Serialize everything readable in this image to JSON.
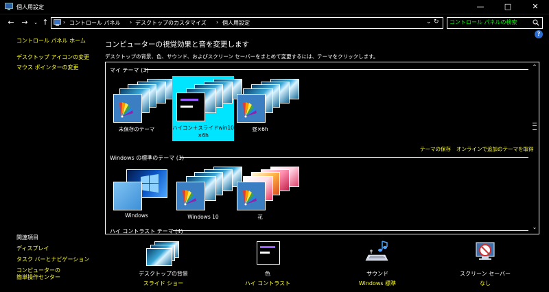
{
  "window": {
    "title": "個人用設定"
  },
  "address": {
    "crumbs": [
      "コントロール パネル",
      "デスクトップのカスタマイズ",
      "個人用設定"
    ],
    "search_placeholder": "コントロール パネルの検索"
  },
  "sidebar": {
    "home": "コントロール パネル ホーム",
    "links": [
      "デスクトップ アイコンの変更",
      "マウス ポインターの変更"
    ],
    "related_title": "関連項目",
    "related": [
      "ディスプレイ",
      "タスク バーとナビゲーション"
    ],
    "ease_line1": "コンピューターの",
    "ease_line2": "簡単操作センター"
  },
  "main": {
    "title": "コンピューターの視覚効果と音を変更します",
    "description": "デスクトップの背景、色、サウンド、およびスクリーン セーバーをまとめて変更するには、テーマをクリックします。",
    "groups": [
      {
        "label": "マイ テーマ (3)",
        "themes": [
          {
            "name": "未保存のテーマ",
            "selected": false
          },
          {
            "name": "ハイコン＋スライドwin10",
            "name2": "×6h",
            "selected": true
          },
          {
            "name": "昼×6h",
            "selected": false
          }
        ]
      },
      {
        "label": "Windows の標準のテーマ (3)",
        "themes": [
          {
            "name": "Windows",
            "selected": false
          },
          {
            "name": "Windows 10",
            "selected": false
          },
          {
            "name": "花",
            "selected": false
          }
        ]
      },
      {
        "label": "ハイ コントラスト テーマ (4)"
      }
    ],
    "save_theme": "テーマの保存",
    "online_themes": "オンラインで追加のテーマを取得"
  },
  "bottom": [
    {
      "label": "デスクトップの背景",
      "value": "スライド ショー",
      "icon": "desktop-background-icon"
    },
    {
      "label": "色",
      "value": "ハイ コントラスト",
      "icon": "color-icon"
    },
    {
      "label": "サウンド",
      "value": "Windows 標準",
      "icon": "sound-icon"
    },
    {
      "label": "スクリーン セーバー",
      "value": "なし",
      "icon": "screensaver-icon"
    }
  ],
  "colors": {
    "link": "#ffff33",
    "selection": "#00e5ff",
    "search_text": "#00ff00"
  }
}
